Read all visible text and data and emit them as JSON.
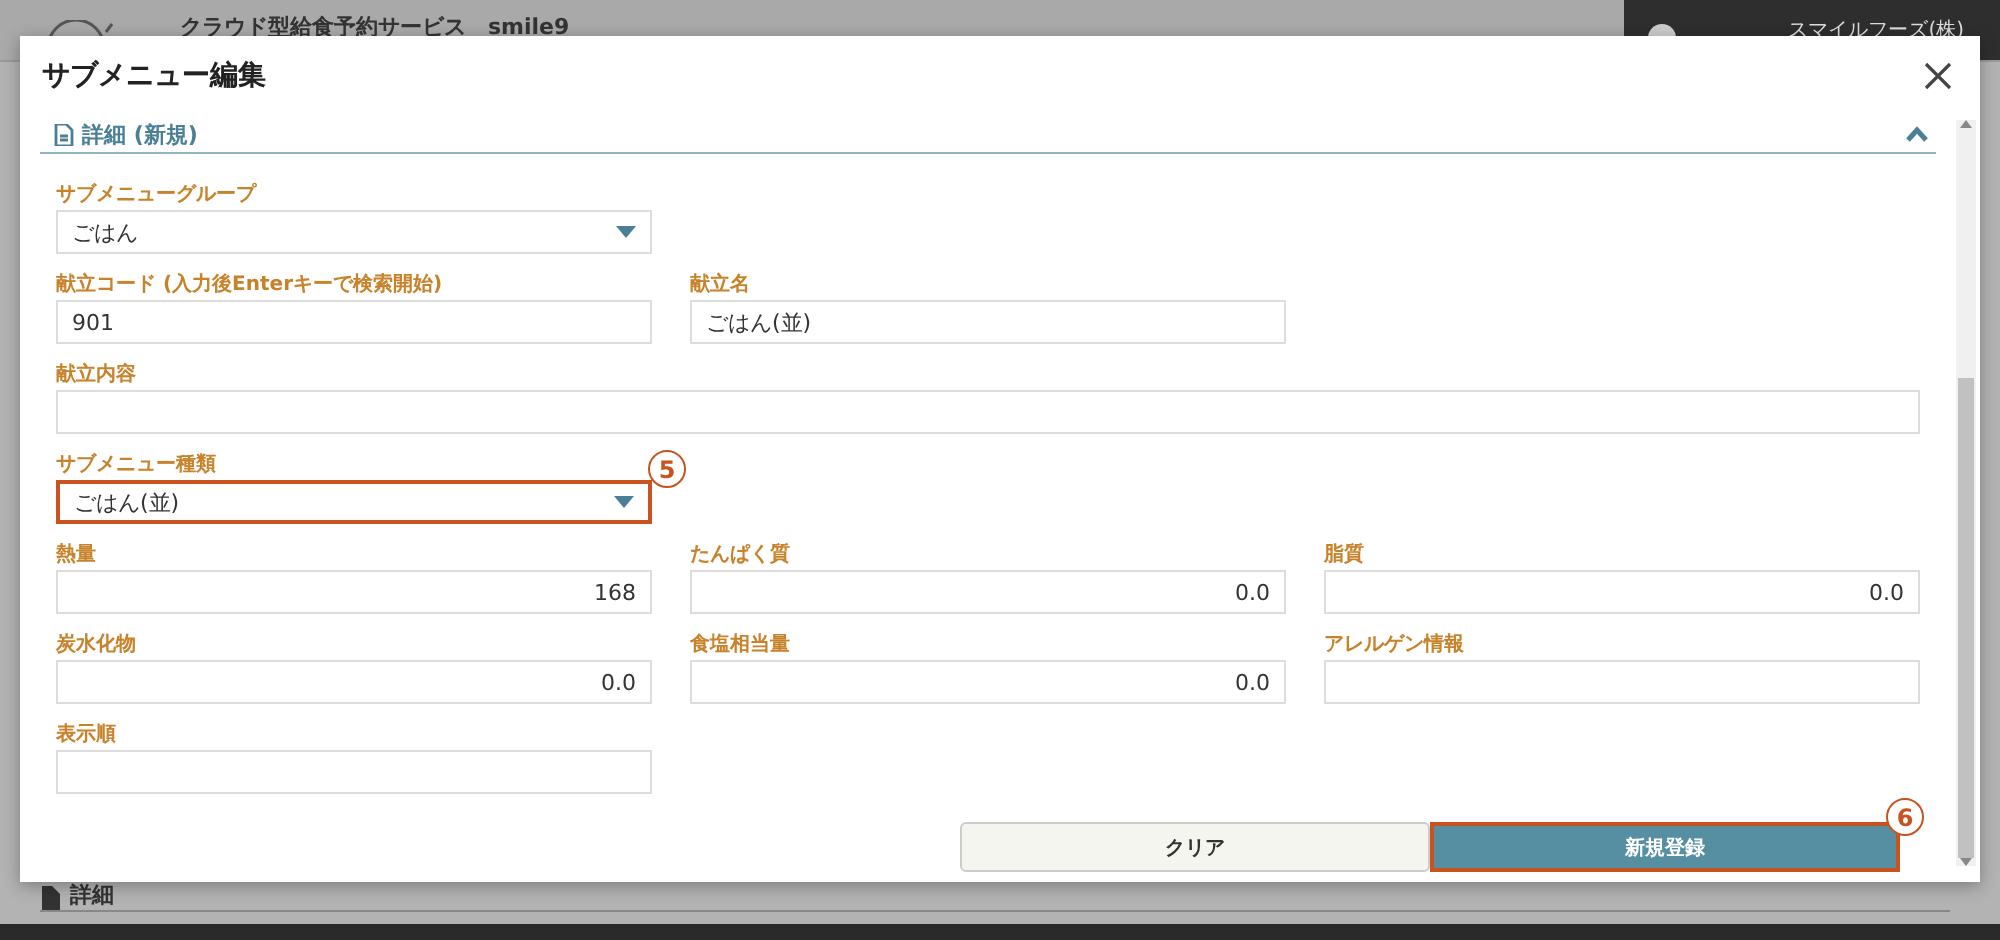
{
  "app_header": {
    "title": "クラウド型給食予約サービス　smile9",
    "user": "スマイルフーズ(株)"
  },
  "background_section": {
    "title": "詳細"
  },
  "dialog": {
    "title": "サブメニュー編集",
    "section": {
      "title": "詳細 (新規)",
      "expanded": true
    },
    "rows": [
      [
        {
          "kind": "select",
          "label": "サブメニューグループ",
          "value": "ごはん"
        }
      ],
      [
        {
          "kind": "text",
          "label": "献立コード (入力後Enterキーで検索開始)",
          "value": "901"
        },
        {
          "kind": "text",
          "label": "献立名",
          "value": "ごはん(並)"
        }
      ],
      [
        {
          "kind": "wide",
          "label": "献立内容"
        }
      ],
      [
        {
          "kind": "select",
          "label": "サブメニュー種類",
          "value": "ごはん(並)",
          "callout": "5"
        }
      ],
      [
        {
          "kind": "number",
          "label": "熱量",
          "value": "168"
        },
        {
          "kind": "number",
          "label": "たんぱく質",
          "value": "0.0"
        },
        {
          "kind": "number",
          "label": "脂質",
          "value": "0.0"
        }
      ],
      [
        {
          "kind": "number",
          "label": "炭水化物",
          "value": "0.0"
        },
        {
          "kind": "number",
          "label": "食塩相当量",
          "value": "0.0"
        },
        {
          "kind": "text",
          "label": "アレルゲン情報"
        }
      ],
      [
        {
          "kind": "text",
          "label": "表示順"
        }
      ]
    ],
    "buttons": [
      {
        "kind": "secondary",
        "label": "クリア"
      },
      {
        "kind": "primary",
        "label": "新規登録",
        "callout": "6"
      }
    ]
  }
}
